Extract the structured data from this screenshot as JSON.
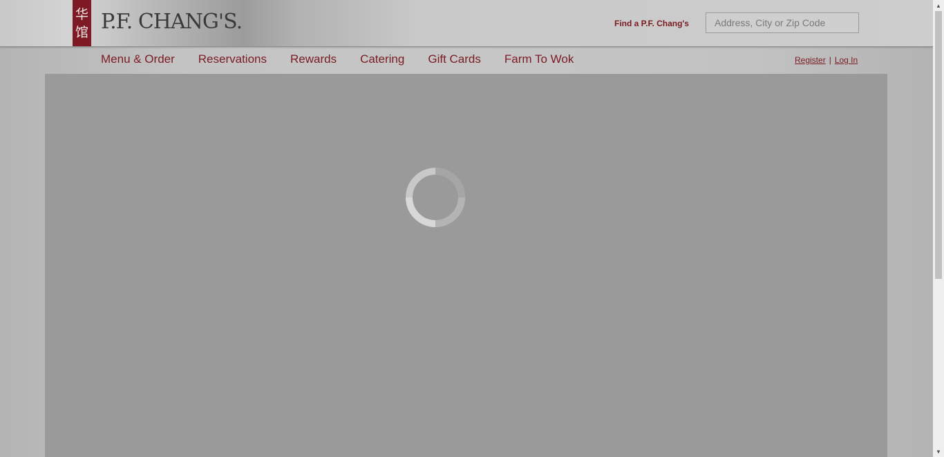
{
  "header": {
    "seal_chars": [
      "华",
      "馆"
    ],
    "logo_text": "P.F. CHANG'S.",
    "find_label": "Find a P.F. Chang's",
    "search_placeholder": "Address, City or Zip Code"
  },
  "nav": {
    "items": [
      {
        "label": "Menu & Order"
      },
      {
        "label": "Reservations"
      },
      {
        "label": "Rewards"
      },
      {
        "label": "Catering"
      },
      {
        "label": "Gift Cards"
      },
      {
        "label": "Farm To Wok"
      }
    ]
  },
  "auth": {
    "register": "Register",
    "separator": "|",
    "login": "Log In"
  },
  "colors": {
    "brand_red": "#7a1b22",
    "seal_red": "#7e1a23",
    "overlay_gray": "#9a9a9a"
  },
  "icons": {
    "spinner": "loading-spinner-icon",
    "scroll_up": "chevron-up-icon",
    "scroll_down": "chevron-down-icon"
  }
}
